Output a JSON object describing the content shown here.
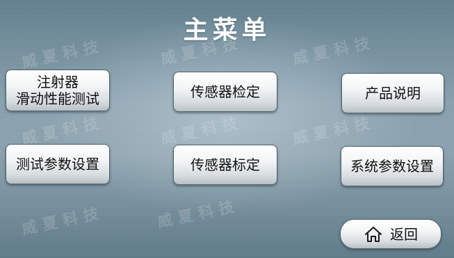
{
  "title": "主菜单",
  "watermark": "威夏科技",
  "buttons": {
    "injection_test": {
      "line1": "注射器",
      "line2": "滑动性能测试"
    },
    "sensor_check": "传感器检定",
    "product_manual": "产品说明",
    "test_params": "测试参数设置",
    "sensor_calibration": "传感器标定",
    "system_params": "系统参数设置",
    "back": "返回"
  },
  "icons": {
    "back_icon": "home-icon"
  },
  "colors": {
    "background": "#8aa1ae",
    "button_face": "#f3f5f6",
    "button_border": "#50636c",
    "title_text": "#ffffff"
  }
}
